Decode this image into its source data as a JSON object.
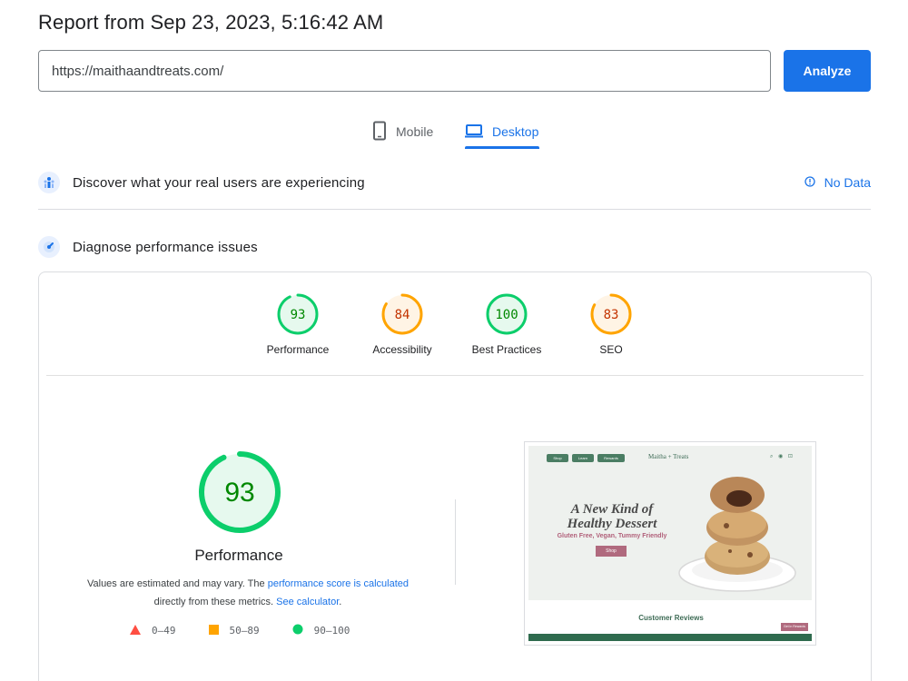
{
  "report": {
    "title": "Report from Sep 23, 2023, 5:16:42 AM"
  },
  "search": {
    "url": "https://maithaandtreats.com/",
    "analyze_label": "Analyze"
  },
  "tabs": [
    {
      "label": "Mobile",
      "icon": "smartphone-icon",
      "active": false
    },
    {
      "label": "Desktop",
      "icon": "laptop-icon",
      "active": true
    }
  ],
  "real_users": {
    "text": "Discover what your real users are experiencing",
    "status": "No Data",
    "icon": "users-icon"
  },
  "diagnose": {
    "text": "Diagnose performance issues",
    "icon": "diagnose-icon"
  },
  "categories": [
    {
      "label": "Performance",
      "score": "93",
      "color": "#0cce6b",
      "text_color": "#008800",
      "bg": "#e6f9ee"
    },
    {
      "label": "Accessibility",
      "score": "84",
      "color": "#ffa400",
      "text_color": "#c33300",
      "bg": "#fff4e5"
    },
    {
      "label": "Best Practices",
      "score": "100",
      "color": "#0cce6b",
      "text_color": "#008800",
      "bg": "#e6f9ee"
    },
    {
      "label": "SEO",
      "score": "83",
      "color": "#ffa400",
      "text_color": "#c33300",
      "bg": "#fff4e5"
    }
  ],
  "performance": {
    "score": "93",
    "title": "Performance",
    "desc_prefix": "Values are estimated and may vary. The ",
    "desc_link1": "performance score is calculated",
    "desc_mid": " directly from these metrics. ",
    "desc_link2": "See calculator",
    "desc_suffix": "."
  },
  "legend": [
    {
      "range": "0–49",
      "shape": "triangle",
      "color": "#ff4e42"
    },
    {
      "range": "50–89",
      "shape": "square",
      "color": "#ffa400"
    },
    {
      "range": "90–100",
      "shape": "circle",
      "color": "#0cce6b"
    }
  ],
  "screenshot": {
    "nav": [
      "Shop",
      "Learn",
      "Rewards"
    ],
    "brand": "Maitha + Treats",
    "headline": "A New Kind of Healthy Dessert",
    "subline": "Gluten Free, Vegan, Tummy Friendly",
    "button": "Shop",
    "reviews": "Customer Reviews",
    "tag": "Get in Rewards"
  }
}
